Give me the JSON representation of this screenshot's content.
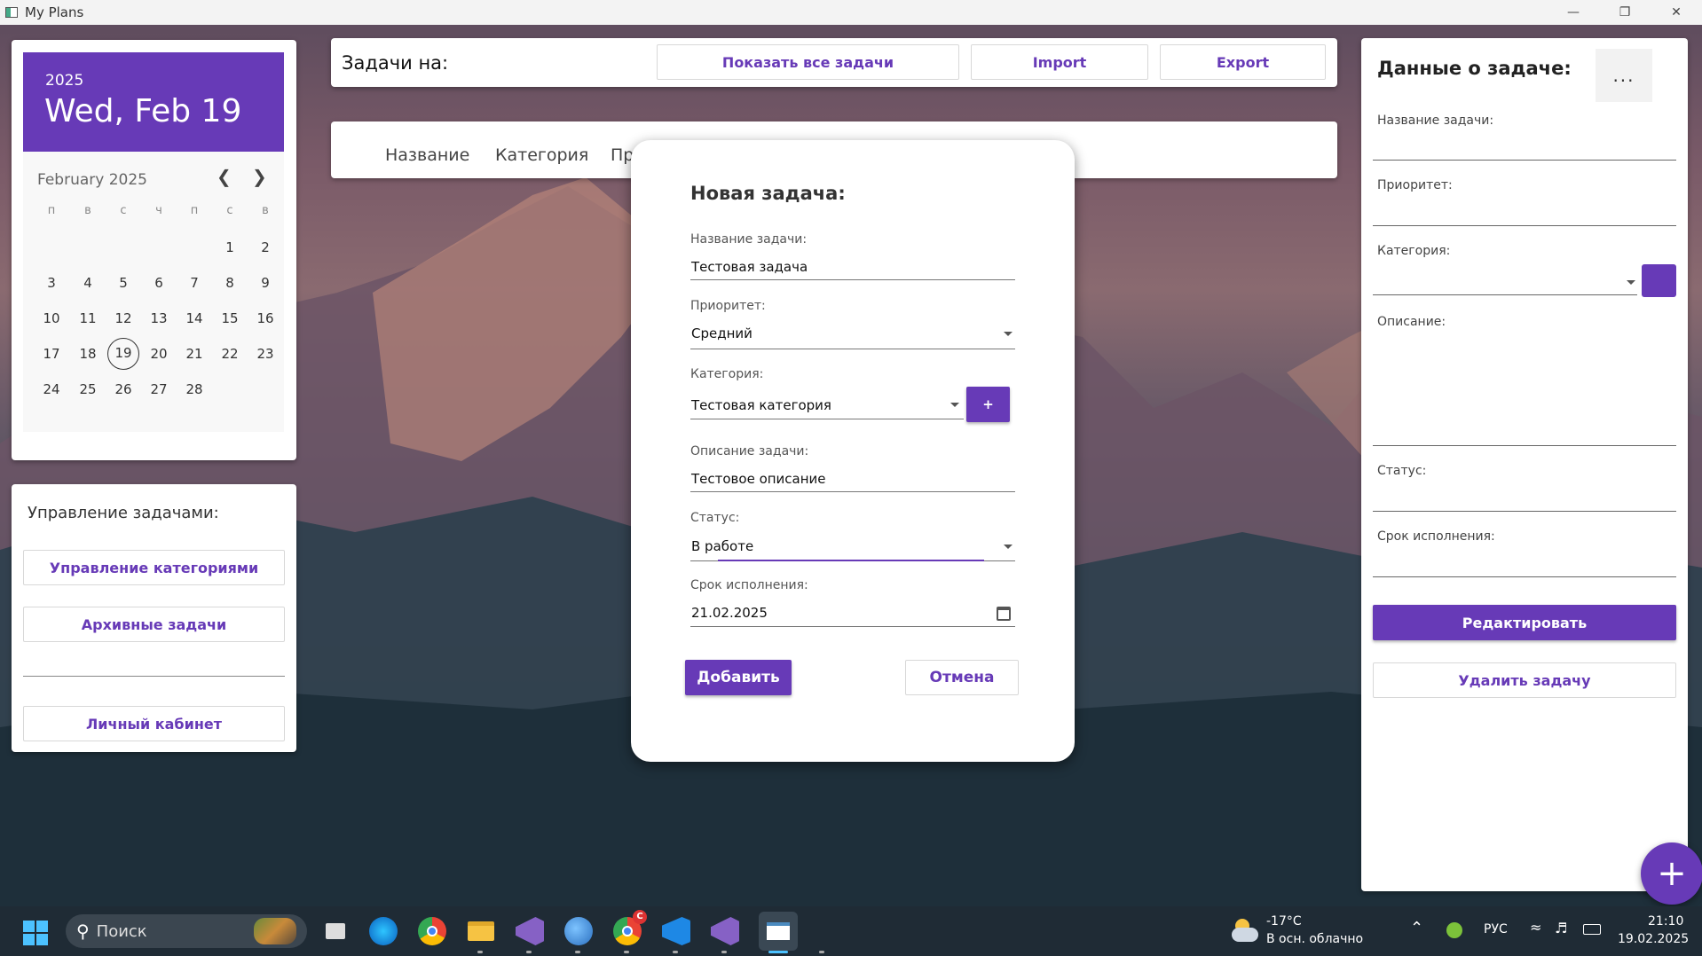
{
  "window": {
    "title": "My Plans"
  },
  "calendar": {
    "year": "2025",
    "date_display": "Wed, Feb 19",
    "month_label": "February 2025",
    "weekdays": [
      "п",
      "в",
      "с",
      "ч",
      "п",
      "с",
      "в"
    ],
    "days": [
      "1",
      "2",
      "3",
      "4",
      "5",
      "6",
      "7",
      "8",
      "9",
      "10",
      "11",
      "12",
      "13",
      "14",
      "15",
      "16",
      "17",
      "18",
      "19",
      "20",
      "21",
      "22",
      "23",
      "24",
      "25",
      "26",
      "27",
      "28"
    ],
    "selected_day": "19"
  },
  "management": {
    "title": "Управление задачами:",
    "categories_button": "Управление категориями",
    "archive_button": "Архивные задачи",
    "account_button": "Личный кабинет"
  },
  "topbar": {
    "label": "Задачи на:",
    "show_all_button": "Показать все задачи",
    "import_button": "Import",
    "export_button": "Export"
  },
  "table": {
    "columns": [
      "Название",
      "Категория",
      "Пр"
    ]
  },
  "dialog": {
    "title": "Новая задача:",
    "name_label": "Название задачи:",
    "name_value": "Тестовая задача",
    "priority_label": "Приоритет:",
    "priority_value": "Средний",
    "category_label": "Категория:",
    "category_value": "Тестовая категория",
    "add_category_button": "+",
    "description_label": "Описание задачи:",
    "description_value": "Тестовое описание",
    "status_label": "Статус:",
    "status_value": "В работе",
    "due_label": "Срок исполнения:",
    "due_value": "21.02.2025",
    "add_button": "Добавить",
    "cancel_button": "Отмена"
  },
  "details": {
    "title": "Данные о задаче:",
    "more_button": "...",
    "name_label": "Название задачи:",
    "priority_label": "Приоритет:",
    "category_label": "Категория:",
    "description_label": "Описание:",
    "status_label": "Статус:",
    "due_label": "Срок исполнения:",
    "edit_button": "Редактировать",
    "delete_button": "Удалить задачу"
  },
  "fab": {
    "label": "+"
  },
  "taskbar": {
    "search_label": "Поиск",
    "weather_temp": "-17°C",
    "weather_desc": "В осн. облачно",
    "language": "РУС",
    "time": "21:10",
    "date": "19.02.2025"
  },
  "colors": {
    "accent": "#673ab7",
    "taskbar": "#1f2b35"
  }
}
